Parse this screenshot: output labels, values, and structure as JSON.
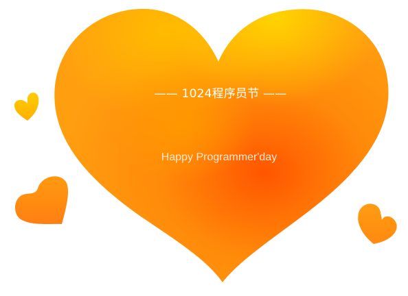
{
  "heading": "—— 1024程序员节 ——",
  "subheading": "Happy Programmer'day",
  "colors": {
    "heart_light": "#ffcc00",
    "heart_mid": "#ff9a0a",
    "heart_dark": "#ff5a00",
    "small_heart_yellow": "#ffc20a",
    "small_heart_orange": "#ff8a10"
  },
  "icons": [
    "large-heart-icon",
    "small-heart-icon"
  ]
}
